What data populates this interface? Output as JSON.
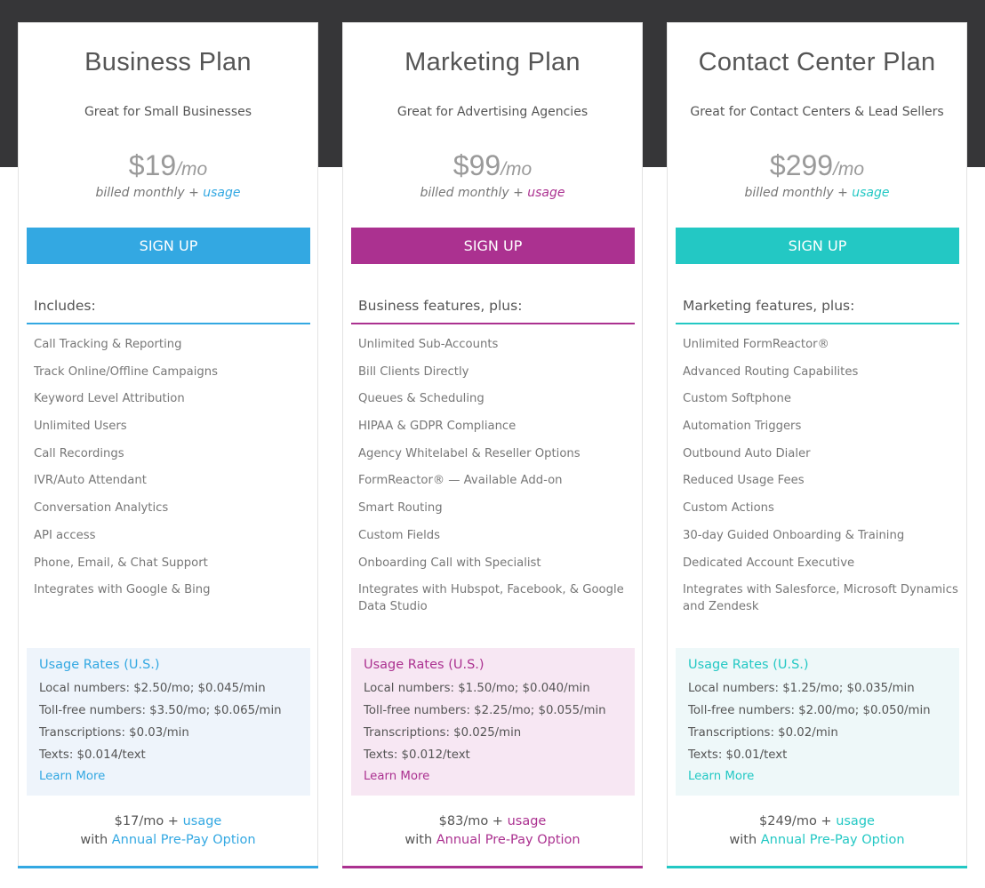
{
  "theme": {
    "hero_bg": "#363638",
    "text": "#555555"
  },
  "plans": [
    {
      "title": "Business Plan",
      "tagline": "Great for Small Businesses",
      "price": "$19",
      "price_unit": "/mo",
      "billed_prefix": "billed monthly + ",
      "billed_link": "usage",
      "signup_label": "SIGN UP",
      "accent": "#33a8e2",
      "usage_bg": "#eef4fb",
      "features_heading": "Includes:",
      "features": [
        "Call Tracking & Reporting",
        "Track Online/Offline Campaigns",
        "Keyword Level Attribution",
        "Unlimited Users",
        "Call Recordings",
        "IVR/Auto Attendant",
        "Conversation Analytics",
        "API access",
        "Phone, Email, & Chat Support",
        "Integrates with Google & Bing"
      ],
      "usage": {
        "title": "Usage Rates (U.S.)",
        "lines": [
          "Local numbers: $2.50/mo; $0.045/min",
          "Toll-free numbers: $3.50/mo; $0.065/min",
          "Transcriptions: $0.03/min",
          "Texts: $0.014/text"
        ],
        "learn_more": "Learn More"
      },
      "annual": {
        "price": "$17/mo + ",
        "usage_link": "usage",
        "with": "with ",
        "option_link": "Annual Pre-Pay Option"
      }
    },
    {
      "title": "Marketing Plan",
      "tagline": "Great for Advertising Agencies",
      "price": "$99",
      "price_unit": "/mo",
      "billed_prefix": "billed monthly + ",
      "billed_link": "usage",
      "signup_label": "SIGN UP",
      "accent": "#ab3190",
      "usage_bg": "#f7e7f3",
      "features_heading": "Business features, plus:",
      "features": [
        "Unlimited Sub-Accounts",
        "Bill Clients Directly",
        "Queues & Scheduling",
        "HIPAA & GDPR Compliance",
        "Agency Whitelabel & Reseller Options",
        "FormReactor® — Available Add-on",
        "Smart Routing",
        "Custom Fields",
        "Onboarding Call with Specialist",
        "Integrates with Hubspot, Facebook, & Google Data Studio"
      ],
      "usage": {
        "title": "Usage Rates (U.S.)",
        "lines": [
          "Local numbers: $1.50/mo; $0.040/min",
          "Toll-free numbers: $2.25/mo; $0.055/min",
          "Transcriptions: $0.025/min",
          "Texts: $0.012/text"
        ],
        "learn_more": "Learn More"
      },
      "annual": {
        "price": "$83/mo + ",
        "usage_link": "usage",
        "with": "with ",
        "option_link": "Annual Pre-Pay Option"
      }
    },
    {
      "title": "Contact Center Plan",
      "tagline": "Great for Contact Centers & Lead Sellers",
      "price": "$299",
      "price_unit": "/mo",
      "billed_prefix": "billed monthly + ",
      "billed_link": "usage",
      "signup_label": "SIGN UP",
      "accent": "#23c8c4",
      "usage_bg": "#eef8f9",
      "features_heading": "Marketing features, plus:",
      "features": [
        "Unlimited FormReactor®",
        "Advanced Routing Capabilites",
        "Custom Softphone",
        "Automation Triggers",
        "Outbound Auto Dialer",
        "Reduced Usage Fees",
        "Custom Actions",
        "30-day Guided Onboarding & Training",
        "Dedicated Account Executive",
        "Integrates with Salesforce, Microsoft Dynamics and Zendesk"
      ],
      "usage": {
        "title": "Usage Rates (U.S.)",
        "lines": [
          "Local numbers: $1.25/mo; $0.035/min",
          "Toll-free numbers: $2.00/mo; $0.050/min",
          "Transcriptions: $0.02/min",
          "Texts: $0.01/text"
        ],
        "learn_more": "Learn More"
      },
      "annual": {
        "price": "$249/mo + ",
        "usage_link": "usage",
        "with": "with ",
        "option_link": "Annual Pre-Pay Option"
      }
    }
  ]
}
